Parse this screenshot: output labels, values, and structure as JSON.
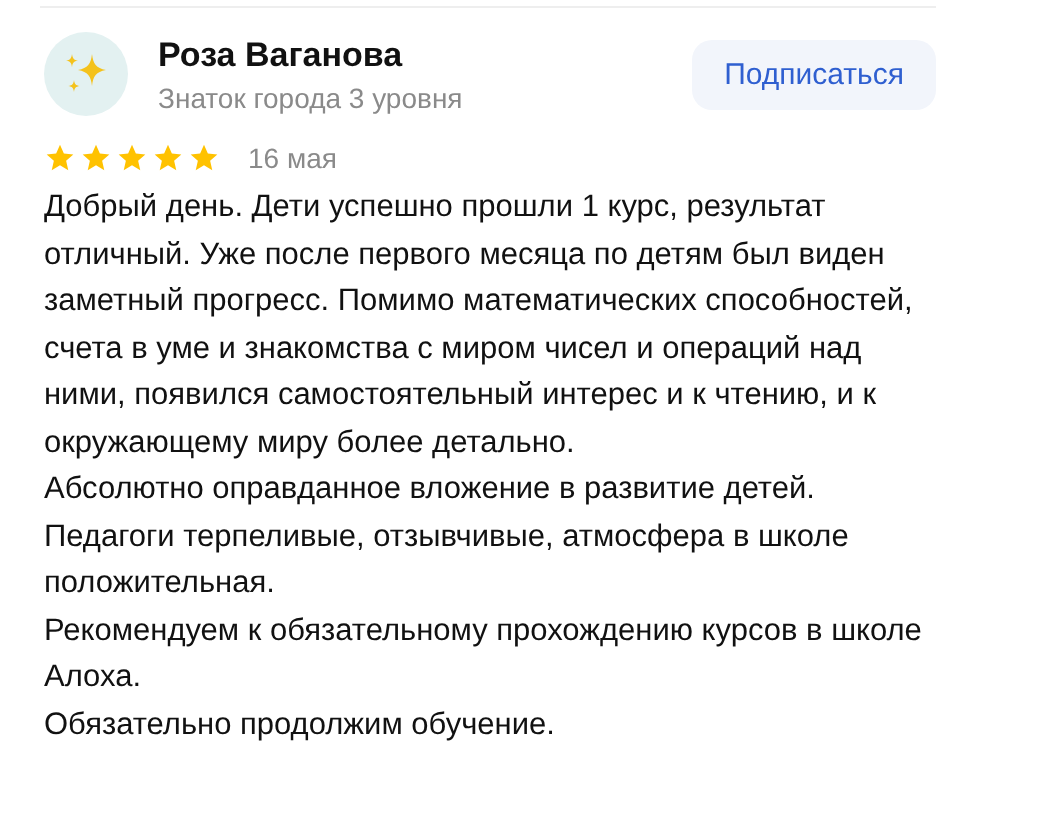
{
  "author": {
    "name": "Роза Ваганова",
    "status": "Знаток города 3 уровня"
  },
  "subscribe_button": "Подписаться",
  "rating": {
    "stars": 5
  },
  "date": "16 мая",
  "paragraphs": [
    "Добрый день. Дети успешно прошли 1 курс, результат отличный. Уже после первого месяца по детям был виден заметный прогресс. Помимо математических способностей, счета в уме и знакомства с миром чисел и операций над ними, появился самостоятельный интерес и к чтению, и к окружающему миру более детально.",
    "Абсолютно оправданное вложение в развитие детей. Педагоги терпеливые, отзывчивые, атмосфера в школе положительная.",
    "Рекомендуем к обязательному прохождению курсов в школе Алоха.",
    "Обязательно продолжим обучение."
  ]
}
